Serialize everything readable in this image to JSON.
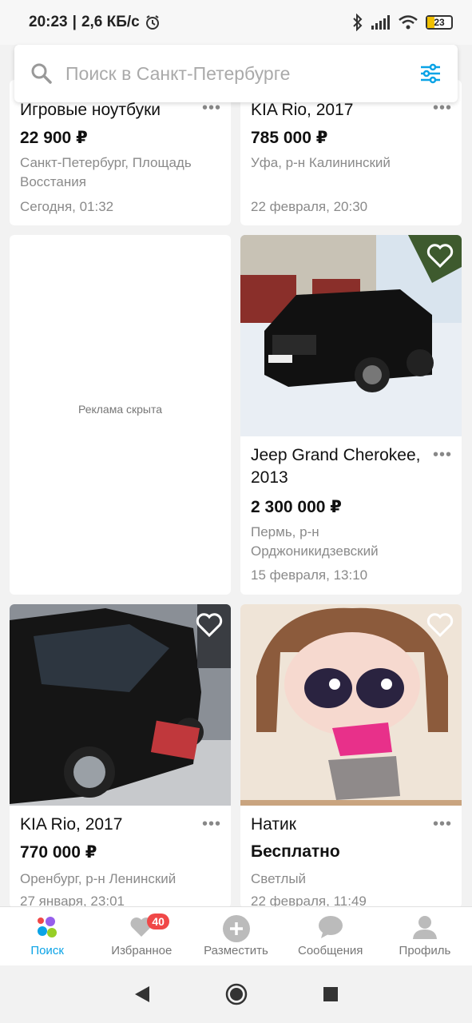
{
  "status_bar": {
    "time": "20:23",
    "speed": "2,6 КБ/с",
    "battery": "23"
  },
  "search": {
    "placeholder": "Поиск в Санкт-Петербурге"
  },
  "listings": [
    {
      "title": "Игровые ноутбуки",
      "price": "22 900 ₽",
      "location": "Санкт-Петербург, Площадь Восстания",
      "date": "Сегодня, 01:32"
    },
    {
      "title": "KIA Rio, 2017",
      "price": "785 000 ₽",
      "location": "Уфа, р-н Калининский",
      "date": "22 февраля, 20:30"
    },
    {
      "ad_text": "Реклама скрыта"
    },
    {
      "title": "Jeep Grand Cherokee, 2013",
      "price": "2 300 000 ₽",
      "location": "Пермь, р-н Орджоникидзевский",
      "date": "15 февраля, 13:10",
      "image": "black-jeep-in-snow"
    },
    {
      "title": "KIA Rio, 2017",
      "price": "770 000 ₽",
      "location": "Оренбург, р-н Ленинский",
      "date": "27 января, 23:01",
      "image": "black-kia-sedan"
    },
    {
      "title": "Натик",
      "price": "Бесплатно",
      "location": "Светлый",
      "date": "22 февраля, 11:49",
      "image": "cartoon-girl-drawing"
    }
  ],
  "bottom_nav": [
    {
      "label": "Поиск",
      "icon": "search-dots-icon",
      "active": true
    },
    {
      "label": "Избранное",
      "icon": "heart-icon",
      "badge": "40"
    },
    {
      "label": "Разместить",
      "icon": "plus-circle-icon"
    },
    {
      "label": "Сообщения",
      "icon": "chat-icon"
    },
    {
      "label": "Профиль",
      "icon": "profile-icon"
    }
  ],
  "colors": {
    "accent": "#0aa3e6",
    "badge": "#f04848"
  }
}
